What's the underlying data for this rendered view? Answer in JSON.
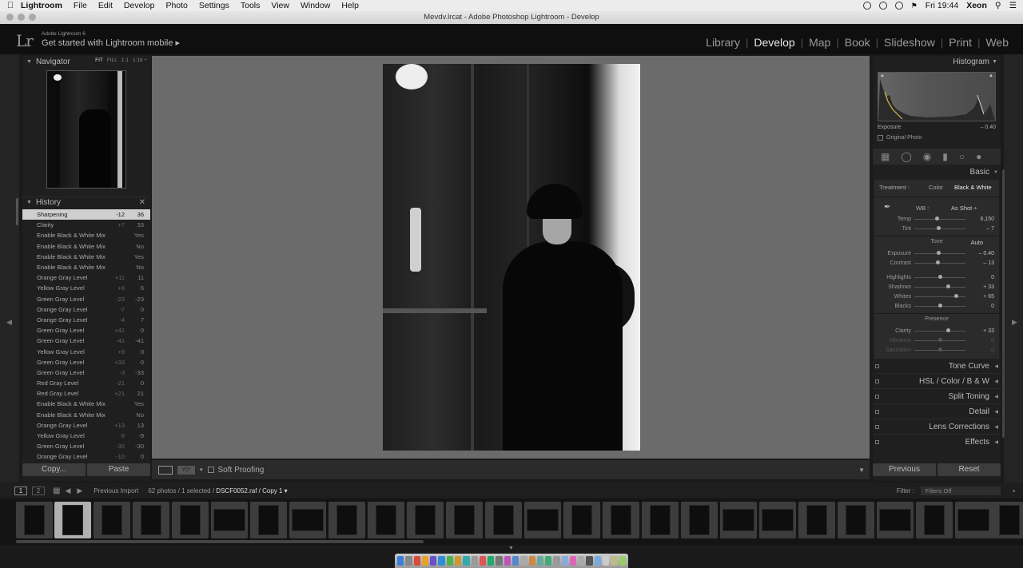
{
  "menubar": {
    "items": [
      "Lightroom",
      "File",
      "Edit",
      "Develop",
      "Photo",
      "Settings",
      "Tools",
      "View",
      "Window",
      "Help"
    ],
    "clock": "Fri 19:44",
    "user": "Xeon"
  },
  "window": {
    "title": "Mevdv.lrcat - Adobe Photoshop Lightroom - Develop"
  },
  "header": {
    "logo": "Lr",
    "version": "Adobe Lightroom 6",
    "mobile": "Get started with Lightroom mobile ▸",
    "modules": [
      "Library",
      "Develop",
      "Map",
      "Book",
      "Slideshow",
      "Print",
      "Web"
    ],
    "active_module": "Develop"
  },
  "navigator": {
    "title": "Navigator",
    "zoom": [
      "FIT",
      "FILL",
      "1:1",
      "1:16 ÷"
    ]
  },
  "history": {
    "title": "History",
    "items": [
      {
        "label": "Sharpening",
        "a": "-12",
        "b": "36"
      },
      {
        "label": "Clarity",
        "a": "+7",
        "b": "33"
      },
      {
        "label": "Enable Black & White Mix",
        "a": "",
        "b": "Yes"
      },
      {
        "label": "Enable Black & White Mix",
        "a": "",
        "b": "No"
      },
      {
        "label": "Enable Black & White Mix",
        "a": "",
        "b": "Yes"
      },
      {
        "label": "Enable Black & White Mix",
        "a": "",
        "b": "No"
      },
      {
        "label": "Orange Gray Level",
        "a": "+11",
        "b": "11"
      },
      {
        "label": "Yellow Gray Level",
        "a": "+6",
        "b": "6"
      },
      {
        "label": "Green Gray Level",
        "a": "-23",
        "b": "-23"
      },
      {
        "label": "Orange Gray Level",
        "a": "-7",
        "b": "0"
      },
      {
        "label": "Orange Gray Level",
        "a": "-4",
        "b": "7"
      },
      {
        "label": "Green Gray Level",
        "a": "+41",
        "b": "0"
      },
      {
        "label": "Green Gray Level",
        "a": "-41",
        "b": "-41"
      },
      {
        "label": "Yellow Gray Level",
        "a": "+9",
        "b": "0"
      },
      {
        "label": "Green Gray Level",
        "a": "+33",
        "b": "0"
      },
      {
        "label": "Green Gray Level",
        "a": "-3",
        "b": "-33"
      },
      {
        "label": "Red Gray Level",
        "a": "-21",
        "b": "0"
      },
      {
        "label": "Red Gray Level",
        "a": "+21",
        "b": "21"
      },
      {
        "label": "Enable Black & White Mix",
        "a": "",
        "b": "Yes"
      },
      {
        "label": "Enable Black & White Mix",
        "a": "",
        "b": "No"
      },
      {
        "label": "Orange Gray Level",
        "a": "+13",
        "b": "13"
      },
      {
        "label": "Yellow Gray Level",
        "a": "-9",
        "b": "-9"
      },
      {
        "label": "Green Gray Level",
        "a": "-30",
        "b": "-30"
      },
      {
        "label": "Orange Gray Level",
        "a": "-10",
        "b": "0"
      }
    ],
    "copy": "Copy...",
    "paste": "Paste"
  },
  "toolbar": {
    "soft_proofing": "Soft Proofing",
    "yy": "Y|Y"
  },
  "right": {
    "histogram_title": "Histogram",
    "exposure_label": "Exposure",
    "exposure_value": "– 0.40",
    "original_photo": "Original Photo",
    "basic_title": "Basic",
    "treatment_label": "Treatment :",
    "treatment_color": "Color",
    "treatment_bw": "Black & White",
    "wb_label": "WB :",
    "wb_value": "As Shot ÷",
    "tone_label": "Tone",
    "auto_label": "Auto",
    "presence_label": "Presence",
    "wb_sliders": [
      {
        "name": "Temp",
        "value": "6,150",
        "pos": 0.45
      },
      {
        "name": "Tint",
        "value": "– 7",
        "pos": 0.47
      }
    ],
    "tone_sliders": [
      {
        "name": "Exposure",
        "value": "– 0.40",
        "pos": 0.47
      },
      {
        "name": "Contrast",
        "value": "– 13",
        "pos": 0.46
      }
    ],
    "tone_sliders2": [
      {
        "name": "Highlights",
        "value": "0",
        "pos": 0.5
      },
      {
        "name": "Shadows",
        "value": "+ 33",
        "pos": 0.66
      },
      {
        "name": "Whites",
        "value": "+ 65",
        "pos": 0.82
      },
      {
        "name": "Blacks",
        "value": "0",
        "pos": 0.5
      }
    ],
    "presence_sliders": [
      {
        "name": "Clarity",
        "value": "+ 33",
        "pos": 0.66,
        "dim": false
      },
      {
        "name": "Vibrance",
        "value": "0",
        "pos": 0.5,
        "dim": true
      },
      {
        "name": "Saturation",
        "value": "0",
        "pos": 0.5,
        "dim": true
      }
    ],
    "sections": [
      "Tone Curve",
      "HSL / Color / B & W",
      "Split Toning",
      "Detail",
      "Lens Corrections",
      "Effects"
    ],
    "previous": "Previous",
    "reset": "Reset"
  },
  "filmstrip": {
    "page1": "1",
    "page2": "2",
    "source": "Previous Import",
    "count": "62 photos / 1 selected /",
    "filename": "DSCF0052.raf / Copy 1 ▾",
    "filter_label": "Filter :",
    "filter_value": "Filters Off"
  }
}
